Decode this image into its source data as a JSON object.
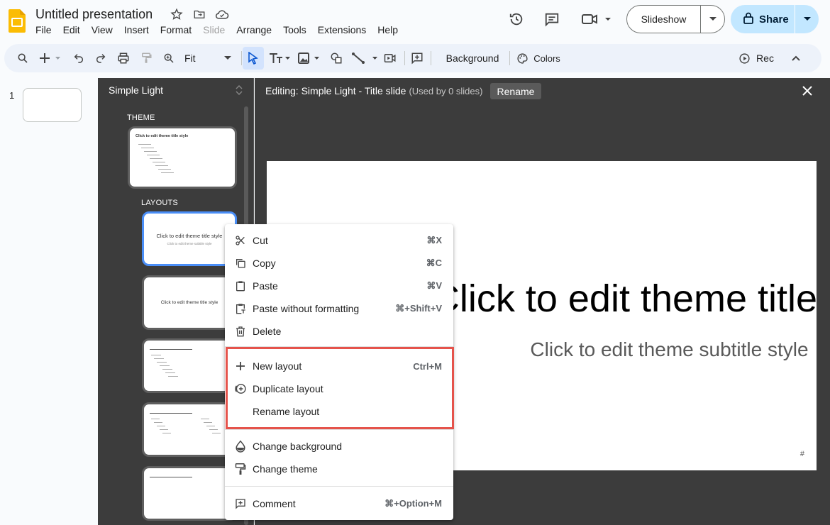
{
  "document": {
    "title": "Untitled presentation"
  },
  "menubar": {
    "items": [
      "File",
      "Edit",
      "View",
      "Insert",
      "Format",
      "Slide",
      "Arrange",
      "Tools",
      "Extensions",
      "Help"
    ]
  },
  "header": {
    "slideshow_label": "Slideshow",
    "share_label": "Share"
  },
  "toolbar": {
    "zoom_label": "Fit",
    "background_label": "Background",
    "colors_label": "Colors",
    "rec_label": "Rec"
  },
  "filmstrip": {
    "slide_number": "1"
  },
  "theme_panel": {
    "theme_name": "Simple Light",
    "theme_section": "THEME",
    "layouts_section": "LAYOUTS",
    "master_thumb_title": "Click to edit theme title style",
    "layout_title_text": "Click to edit theme title style",
    "layout_subtitle_text": "Click to edit theme subtitle style",
    "section_header_text": "Click to edit theme title style"
  },
  "editor": {
    "title": "Editing: Simple Light - Title slide",
    "used_by": "(Used by 0 slides)",
    "rename_label": "Rename",
    "slide_title": "Click to edit theme title style",
    "slide_subtitle": "Click to edit theme subtitle style",
    "slide_number": "#"
  },
  "context_menu": {
    "cut": {
      "label": "Cut",
      "shortcut": "⌘X"
    },
    "copy": {
      "label": "Copy",
      "shortcut": "⌘C"
    },
    "paste": {
      "label": "Paste",
      "shortcut": "⌘V"
    },
    "paste_plain": {
      "label": "Paste without formatting",
      "shortcut": "⌘+Shift+V"
    },
    "delete": {
      "label": "Delete"
    },
    "new_layout": {
      "label": "New layout",
      "shortcut": "Ctrl+M"
    },
    "duplicate_layout": {
      "label": "Duplicate layout"
    },
    "rename_layout": {
      "label": "Rename layout"
    },
    "change_background": {
      "label": "Change background"
    },
    "change_theme": {
      "label": "Change theme"
    },
    "comment": {
      "label": "Comment",
      "shortcut": "⌘+Option+M"
    }
  },
  "colors": {
    "accent_blue": "#4a8ef7",
    "highlight_red": "#e5534b",
    "share_bg": "#c2e7ff",
    "panel_dark": "#3c3c3c"
  },
  "icons": [
    "slides-logo-icon",
    "star-icon",
    "move-folder-icon",
    "cloud-saved-icon",
    "history-icon",
    "comments-icon",
    "meet-icon",
    "lock-icon",
    "search-icon",
    "add-icon",
    "undo-icon",
    "redo-icon",
    "print-icon",
    "paint-format-icon",
    "zoom-icon",
    "select-icon",
    "text-box-icon",
    "image-icon",
    "shape-icon",
    "line-icon",
    "video-icon",
    "comment-add-icon",
    "palette-icon",
    "rec-icon",
    "collapse-icon",
    "close-icon"
  ]
}
